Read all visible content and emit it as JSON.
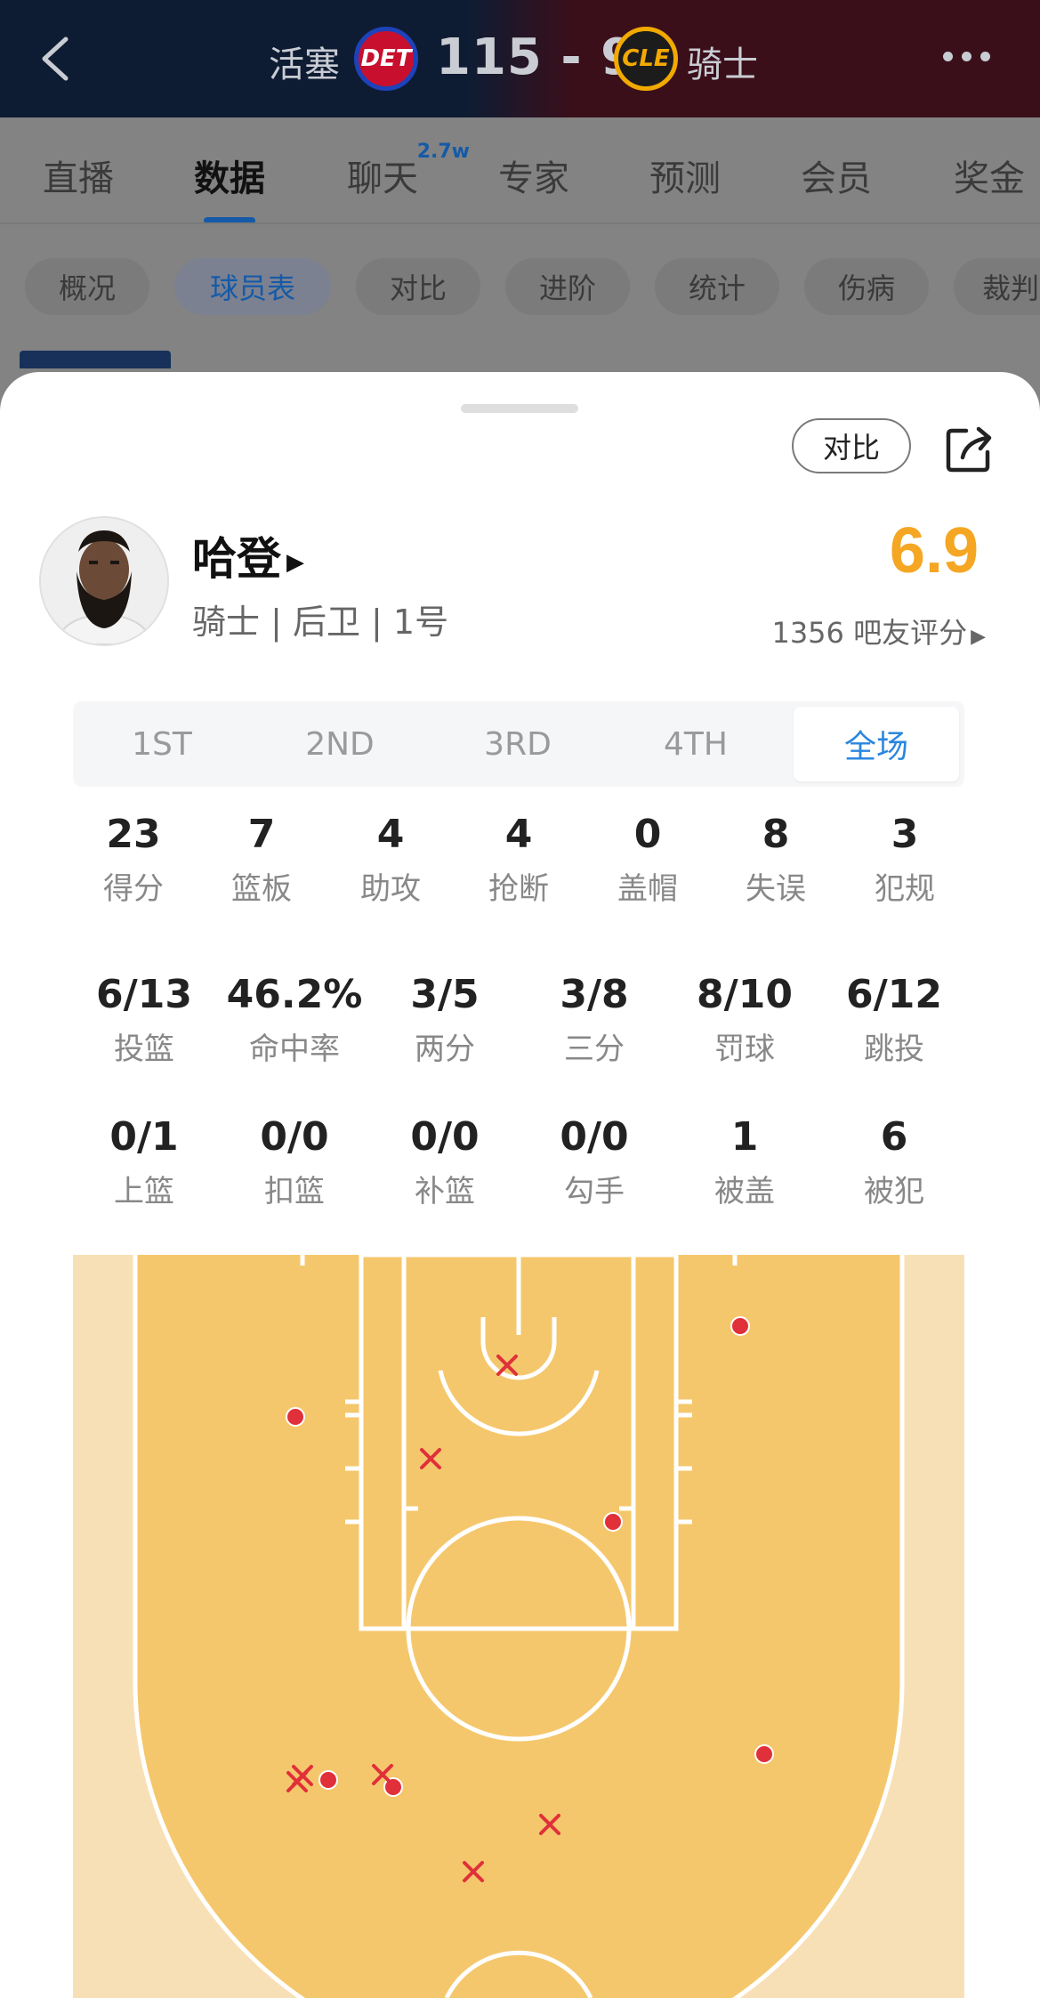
{
  "header": {
    "home_team": "活塞",
    "home_abbr": "DET",
    "score": "115 - 94",
    "away_team": "骑士",
    "away_abbr": "CLE",
    "colors": {
      "home_bg": "#0e1c33",
      "away_bg": "#3a0f1a"
    }
  },
  "nav": {
    "tabs": [
      {
        "label": "直播"
      },
      {
        "label": "数据"
      },
      {
        "label": "聊天",
        "badge": "2.7w"
      },
      {
        "label": "专家"
      },
      {
        "label": "预测"
      },
      {
        "label": "会员"
      },
      {
        "label": "奖金"
      }
    ],
    "active_tab": "数据"
  },
  "subnav": {
    "chips": [
      "概况",
      "球员表",
      "对比",
      "进阶",
      "统计",
      "伤病",
      "裁判"
    ],
    "active_chip": "球员表"
  },
  "player_sheet": {
    "compare_label": "对比",
    "player_name": "哈登",
    "player_meta": "骑士 | 后卫 | 1号",
    "rating": "6.9",
    "rating_count": "1356 吧友评分",
    "accent_color": "#f5a623",
    "periods": [
      "1ST",
      "2ND",
      "3RD",
      "4TH",
      "全场"
    ],
    "active_period": "全场",
    "basic_stats": [
      {
        "value": "23",
        "label": "得分"
      },
      {
        "value": "7",
        "label": "篮板"
      },
      {
        "value": "4",
        "label": "助攻"
      },
      {
        "value": "4",
        "label": "抢断"
      },
      {
        "value": "0",
        "label": "盖帽"
      },
      {
        "value": "8",
        "label": "失误"
      },
      {
        "value": "3",
        "label": "犯规"
      }
    ],
    "shooting_stats": [
      {
        "value": "6/13",
        "label": "投篮"
      },
      {
        "value": "46.2%",
        "label": "命中率"
      },
      {
        "value": "3/5",
        "label": "两分"
      },
      {
        "value": "3/8",
        "label": "三分"
      },
      {
        "value": "8/10",
        "label": "罚球"
      },
      {
        "value": "6/12",
        "label": "跳投"
      }
    ],
    "shot_type_stats": [
      {
        "value": "0/1",
        "label": "上篮"
      },
      {
        "value": "0/0",
        "label": "扣篮"
      },
      {
        "value": "0/0",
        "label": "补篮"
      },
      {
        "value": "0/0",
        "label": "勾手"
      },
      {
        "value": "1",
        "label": "被盖"
      },
      {
        "value": "6",
        "label": "被犯"
      }
    ],
    "shot_chart": {
      "made_color": "#e0303a",
      "missed_color": "#e0303a",
      "court_inside_color": "#f5c76c",
      "court_outside_color": "#f8e0b6"
    }
  }
}
